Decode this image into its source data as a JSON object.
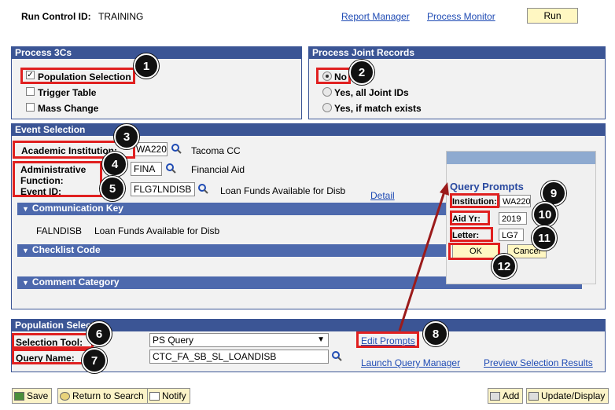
{
  "header": {
    "run_control_label": "Run Control ID:",
    "run_control_value": "TRAINING",
    "report_manager": "Report Manager",
    "process_monitor": "Process Monitor",
    "run_button": "Run"
  },
  "process3cs": {
    "title": "Process 3Cs",
    "population_selection": "Population Selection",
    "trigger_table": "Trigger Table",
    "mass_change": "Mass Change"
  },
  "joint": {
    "title": "Process Joint Records",
    "no": "No",
    "yes_all": "Yes, all Joint IDs",
    "yes_match": "Yes, if match exists"
  },
  "event": {
    "title": "Event Selection",
    "institution_label": "Academic Institution:",
    "institution_value": "WA220",
    "institution_desc": "Tacoma CC",
    "admin_label_line1": "Administrative",
    "admin_label_line2": "Function:",
    "admin_value": "FINA",
    "admin_desc": "Financial Aid",
    "event_id_label": "Event ID:",
    "event_id_value": "FLG7LNDISB",
    "event_id_desc": "Loan Funds Available for Disb",
    "detail_link": "Detail"
  },
  "comm_key": {
    "title": "Communication Key",
    "code": "FALNDISB",
    "desc": "Loan Funds Available for Disb"
  },
  "checklist": {
    "title": "Checklist Code"
  },
  "comment": {
    "title": "Comment Category"
  },
  "query_prompts": {
    "title": "Query Prompts",
    "institution_label": "Institution:",
    "institution_value": "WA220",
    "aid_yr_label": "Aid Yr:",
    "aid_yr_value": "2019",
    "letter_label": "Letter:",
    "letter_value": "LG7",
    "ok": "OK",
    "cancel": "Cancel"
  },
  "population": {
    "title": "Population Selection",
    "tool_label": "Selection Tool:",
    "tool_value": "PS Query",
    "query_label": "Query Name:",
    "query_value": "CTC_FA_SB_SL_LOANDISB",
    "edit_prompts": "Edit Prompts",
    "launch_query": "Launch Query Manager",
    "preview": "Preview Selection Results"
  },
  "footer": {
    "save": "Save",
    "return_search": "Return to Search",
    "notify": "Notify",
    "add": "Add",
    "update_display": "Update/Display"
  },
  "badges": [
    "1",
    "2",
    "3",
    "4",
    "5",
    "6",
    "7",
    "8",
    "9",
    "10",
    "11",
    "12"
  ],
  "colors": {
    "section_bar": "#3b5595",
    "sub_bar": "#4d69ad",
    "annotation_red": "#e02020",
    "button_yellow": "#fff7c2",
    "arrow": "#9b1b1b"
  }
}
